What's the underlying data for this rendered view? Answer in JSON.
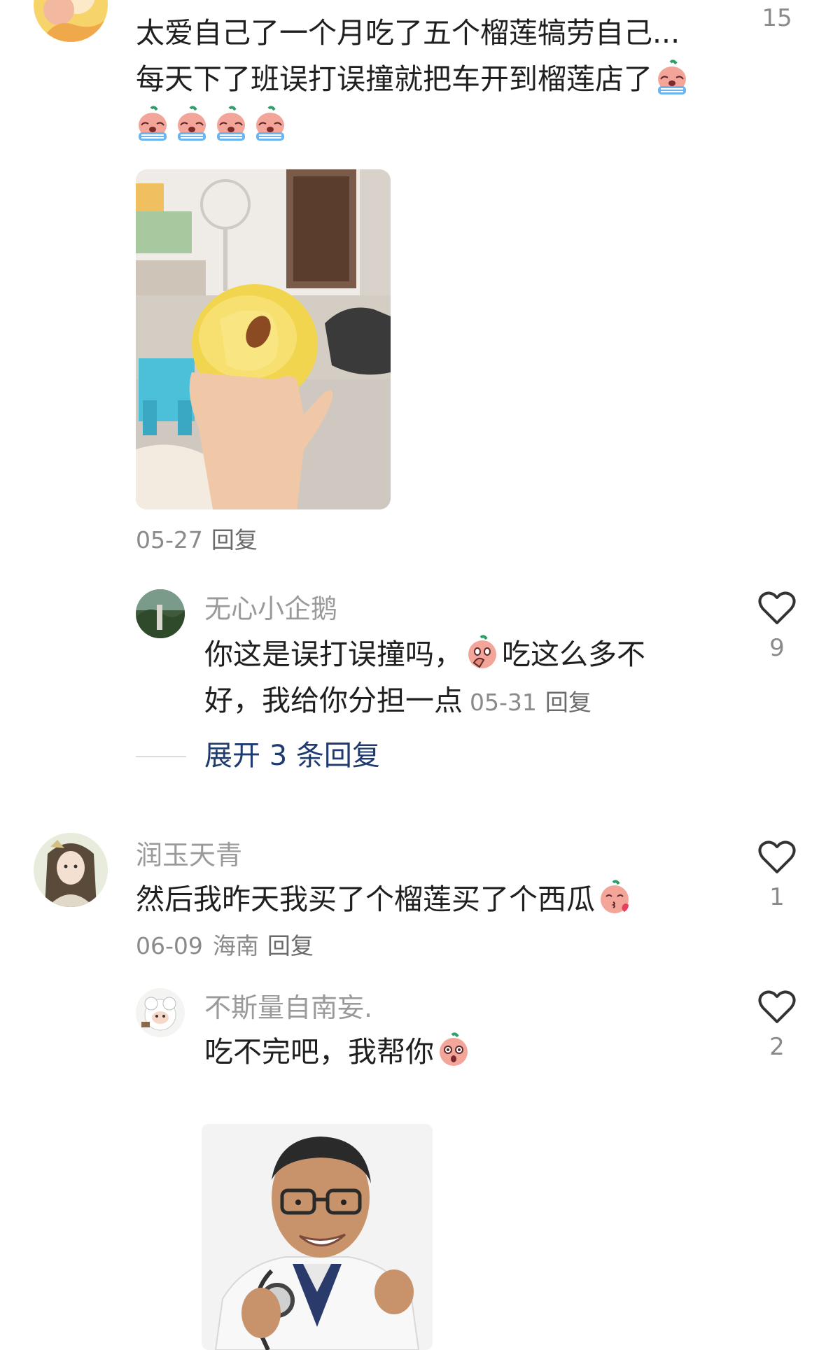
{
  "comments": [
    {
      "username": "",
      "text_line1": "太爱自己了一个月吃了五个榴莲犒劳自己...",
      "text_line2": "每天下了班误打误撞就把车开到榴莲店了",
      "like_count": "15",
      "date": "05-27",
      "reply_label": "回复",
      "emoji_line1": "crying-emoji",
      "emoji_line3": [
        "crying-emoji",
        "crying-emoji",
        "crying-emoji",
        "crying-emoji"
      ],
      "image": "durian-in-hand-photo",
      "replies": [
        {
          "username": "无心小企鹅",
          "text_part1": "你这是误打误撞吗，",
          "text_part2": "吃这么多不",
          "text_line2": "好，我给你分担一点",
          "date": "05-31",
          "reply_label": "回复",
          "like_count": "9",
          "emoji": "covering-mouth-emoji"
        }
      ],
      "expand_label": "展开 3 条回复"
    },
    {
      "username": "润玉天青",
      "text": "然后我昨天我买了个榴莲买了个西瓜",
      "date": "06-09",
      "location": "海南",
      "reply_label": "回复",
      "like_count": "1",
      "emoji": "kissing-emoji",
      "replies": [
        {
          "username": "不斯量自南妄.",
          "text": "吃不完吧，我帮你",
          "like_count": "2",
          "emoji": "surprised-emoji",
          "sticker": "doctor-stethoscope-meme"
        }
      ]
    }
  ],
  "colors": {
    "link": "#1e3a6e",
    "secondary": "#9a9a9a",
    "emoji_face": "#f3a59a",
    "emoji_leaf": "#2e9e6a"
  }
}
